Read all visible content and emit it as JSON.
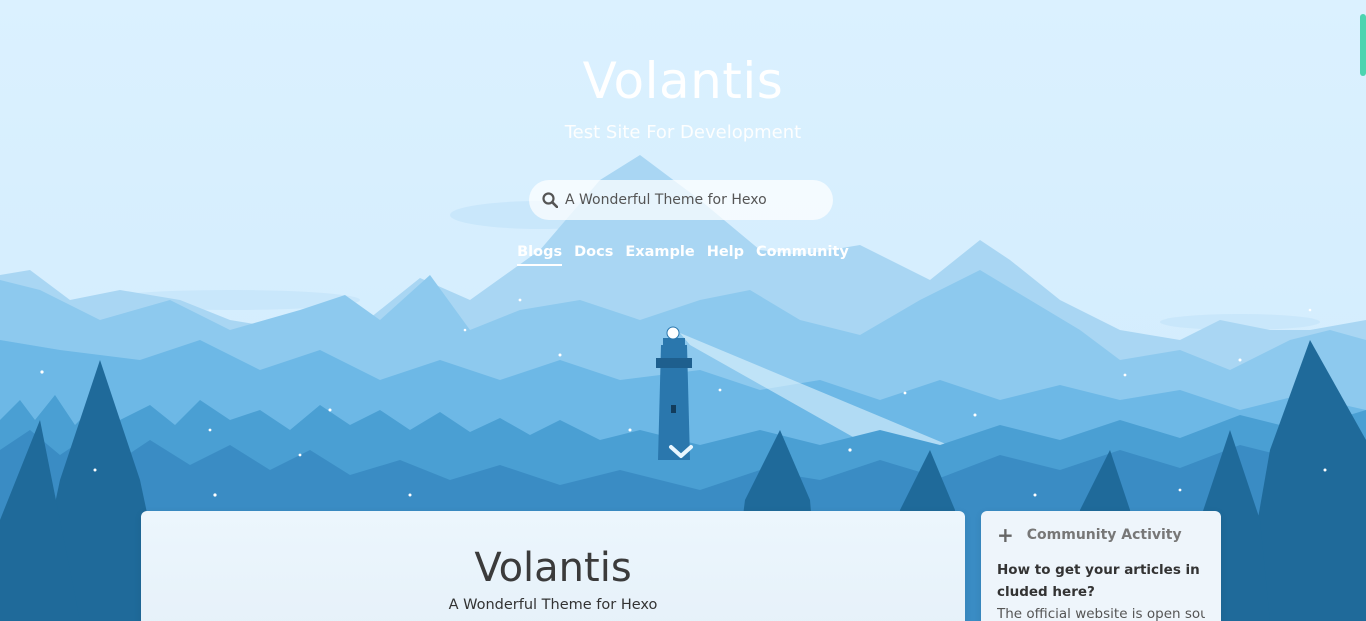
{
  "header": {
    "site_title": "Volantis",
    "site_subtitle": "Test Site For Development"
  },
  "search": {
    "placeholder": "A Wonderful Theme for Hexo"
  },
  "nav": {
    "items": [
      {
        "label": "Blogs",
        "active": true
      },
      {
        "label": "Docs"
      },
      {
        "label": "Example"
      },
      {
        "label": "Help"
      },
      {
        "label": "Community"
      }
    ]
  },
  "main_card": {
    "title": "Volantis",
    "subtitle": "A Wonderful Theme for Hexo"
  },
  "side_card": {
    "header": "Community Activity",
    "post_title": "How to get your articles included here?",
    "post_excerpt": "The official website is open sourc"
  },
  "colors": {
    "sky": "#d8efff",
    "scroll_thumb": "#4dd4b0"
  },
  "icons": {
    "search": "search-icon",
    "scroll_down": "chevron-down-icon",
    "sidebar_plus": "plus-icon"
  }
}
